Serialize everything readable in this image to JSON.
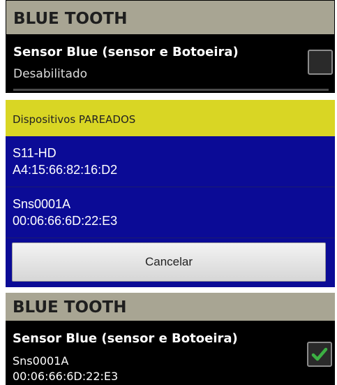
{
  "settings_top": {
    "header": "BLUE TOOTH",
    "title": "Sensor Blue (sensor e Botoeira)",
    "status": "Desabilitado",
    "checked": false
  },
  "dialog": {
    "title": "Dispositivos PAREADOS",
    "devices": [
      {
        "name": "S11-HD",
        "address": "A4:15:66:82:16:D2"
      },
      {
        "name": "Sns0001A",
        "address": "00:06:66:6D:22:E3"
      }
    ],
    "cancel_label": "Cancelar"
  },
  "settings_bottom": {
    "header": "BLUE TOOTH",
    "title": "Sensor Blue (sensor e Botoeira)",
    "device_name": "Sns0001A",
    "device_address": "00:06:66:6D:22:E3",
    "checked": true
  },
  "colors": {
    "header_gray": "#a8a593",
    "dialog_title_yellow": "#d9d624",
    "dialog_blue": "#0b0b96",
    "check_green": "#3cb043"
  },
  "icons": {
    "checkbox_checked": "checkmark-icon"
  }
}
